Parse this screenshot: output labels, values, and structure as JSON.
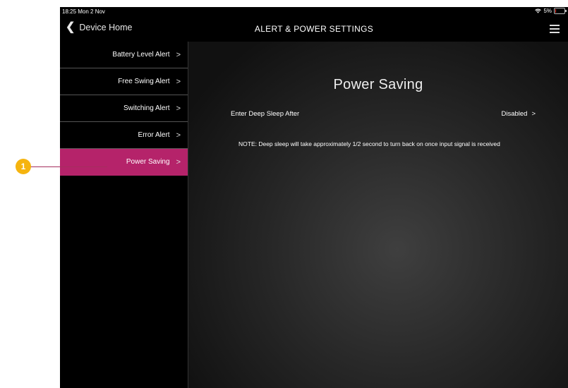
{
  "status_bar": {
    "time": "18:25  Mon 2 Nov",
    "battery": "5%",
    "battery_level": 0.05
  },
  "navbar": {
    "back_label": "Device Home",
    "title": "ALERT & POWER SETTINGS"
  },
  "sidebar": {
    "items": [
      {
        "label": "Battery Level Alert",
        "active": false
      },
      {
        "label": "Free Swing Alert",
        "active": false
      },
      {
        "label": "Switching Alert",
        "active": false
      },
      {
        "label": "Error Alert",
        "active": false
      },
      {
        "label": "Power Saving",
        "active": true
      }
    ]
  },
  "main": {
    "title": "Power Saving",
    "setting": {
      "label": "Enter Deep Sleep After",
      "value": "Disabled"
    },
    "note": "NOTE: Deep sleep will take approximately 1/2 second to turn back on once input signal is received"
  },
  "callout": {
    "number": "1"
  },
  "colors": {
    "accent": "#b5236a",
    "callout": "#f5b40f",
    "background": "#000000"
  }
}
